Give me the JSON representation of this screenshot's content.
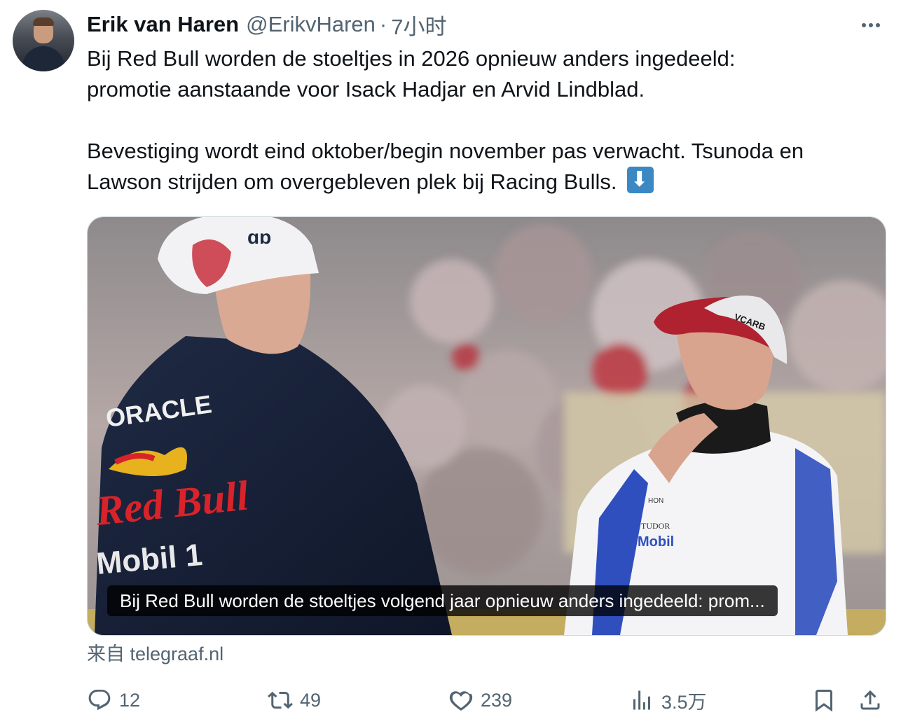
{
  "tweet": {
    "author_name": "Erik van Haren",
    "author_handle": "@ErikvHaren",
    "separator": "·",
    "time": "7小时",
    "lines": [
      "Bij Red Bull worden de stoeltjes in 2026 opnieuw anders ingedeeld:",
      "promotie aanstaande voor Isack Hadjar en Arvid Lindblad.",
      "Bevestiging wordt eind oktober/begin november pas verwacht. Tsunoda en",
      "Lawson strijden om overgebleven plek bij Racing Bulls."
    ],
    "emoji": "down-arrow-button"
  },
  "card": {
    "caption": "Bij Red Bull worden de stoeltjes volgend jaar opnieuw anders ingedeeld: prom...",
    "source": "来自 telegraaf.nl",
    "photo_text": {
      "oracle": "ORACLE",
      "redbull": "Red Bull",
      "mobil": "Mobil 1",
      "right_mobil": "Mobil",
      "tudor": "TUDOR",
      "hon": "HON",
      "vcarb": "VCARB",
      "ao": "ɑɒ"
    }
  },
  "actions": {
    "replies": "12",
    "reposts": "49",
    "likes": "239",
    "views": "3.5万"
  },
  "colors": {
    "text": "#0f1419",
    "secondary": "#536471",
    "border": "#cfd9de",
    "emoji_blue": "#3b88c3"
  }
}
